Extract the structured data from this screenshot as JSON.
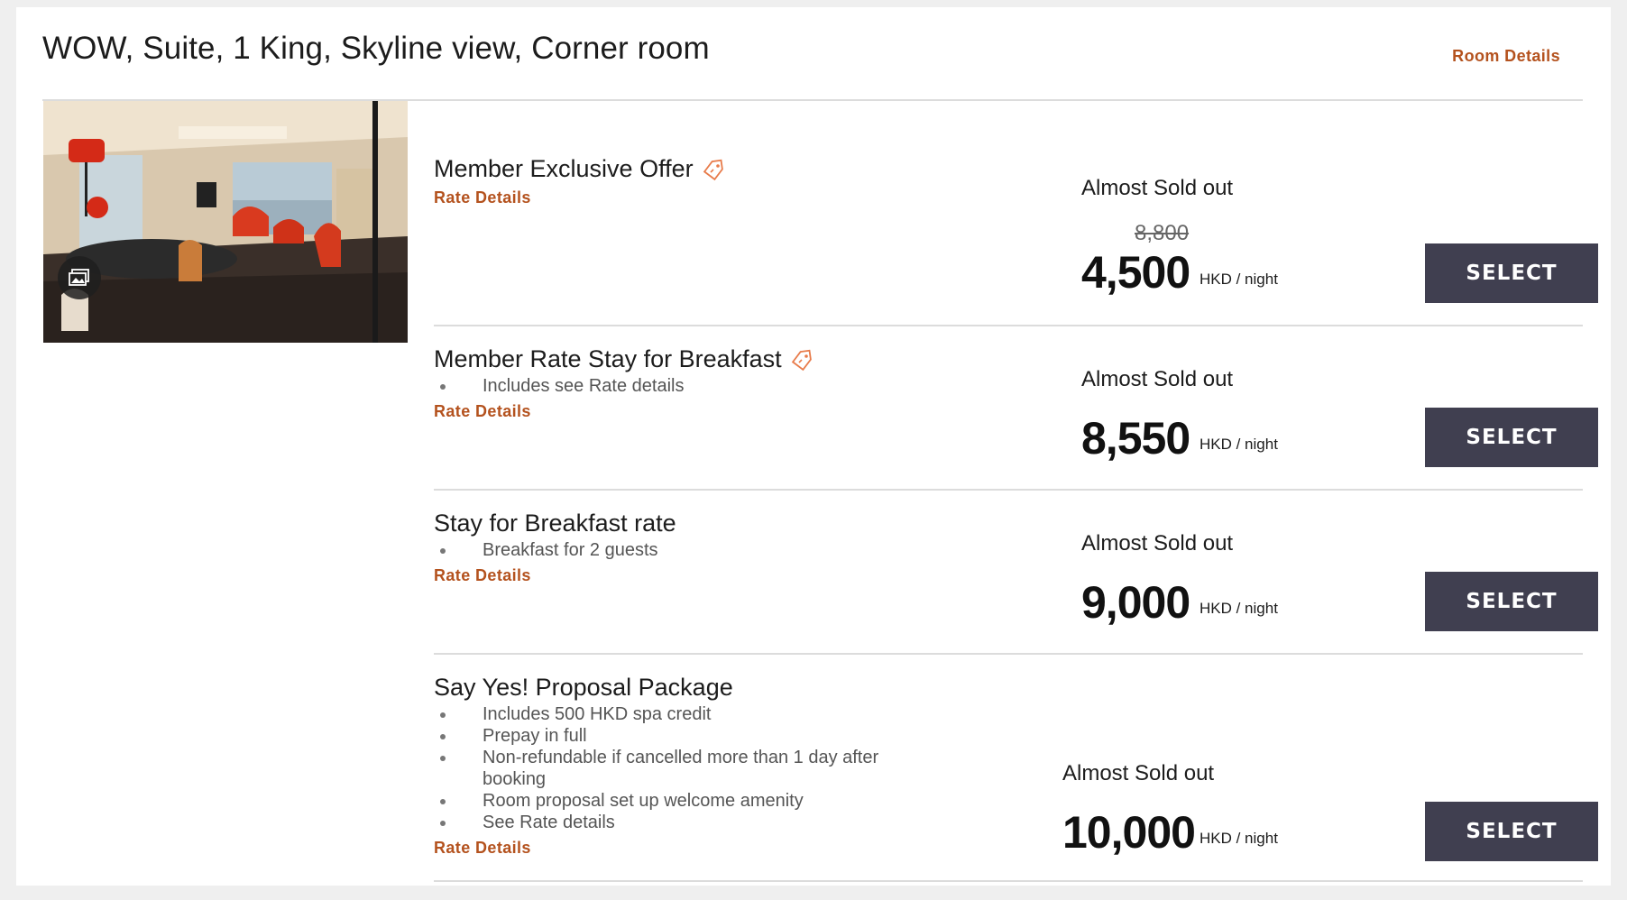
{
  "room": {
    "title": "WOW, Suite, 1 King, Skyline view, Corner room",
    "details_link": "Room Details"
  },
  "icons": {
    "gallery": "gallery-icon",
    "offer_tag": "tag-icon"
  },
  "colors": {
    "accent": "#b4521e",
    "button": "#403f50",
    "tag": "#e87b4a"
  },
  "rates": [
    {
      "name": "Member Exclusive Offer",
      "has_tag": true,
      "bullets": [],
      "link": "Rate Details",
      "availability": "Almost Sold out",
      "original_price": "8,800",
      "price": "4,500",
      "unit": "HKD / night",
      "button": "SELECT"
    },
    {
      "name": "Member Rate Stay for Breakfast",
      "has_tag": true,
      "bullets": [
        "Includes see Rate details"
      ],
      "link": "Rate Details",
      "availability": "Almost Sold out",
      "price": "8,550",
      "unit": "HKD / night",
      "button": "SELECT"
    },
    {
      "name": "Stay for Breakfast rate",
      "has_tag": false,
      "bullets": [
        "Breakfast for 2 guests"
      ],
      "link": "Rate Details",
      "availability": "Almost Sold out",
      "price": "9,000",
      "unit": "HKD / night",
      "button": "SELECT"
    },
    {
      "name": "Say Yes! Proposal Package",
      "has_tag": false,
      "bullets": [
        "Includes 500 HKD spa credit",
        "Prepay in full",
        "Non-refundable if cancelled more than 1 day after booking",
        "Room proposal set up welcome amenity",
        "See Rate details"
      ],
      "link": "Rate Details",
      "availability": "Almost Sold out",
      "price": "10,000",
      "unit": "HKD / night",
      "button": "SELECT"
    }
  ]
}
